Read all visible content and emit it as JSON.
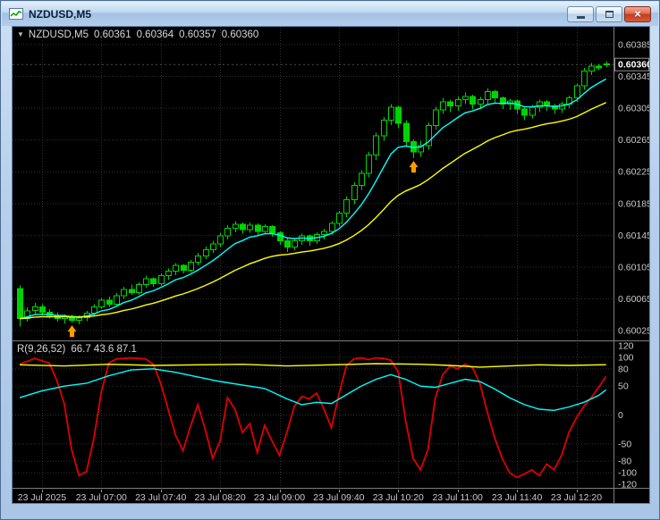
{
  "window": {
    "title": "NZDUSD,M5",
    "icons": {
      "minimize": "minimize-bar",
      "maximize": "restore-box",
      "close": "×"
    }
  },
  "main_chart": {
    "dropdown_glyph": "▼",
    "symbol": "NZDUSD,M5",
    "open": "0.60361",
    "high": "0.60364",
    "low": "0.60357",
    "close": "0.60360"
  },
  "indicator_pane": {
    "name": "R(9,26,52)",
    "values_text": "66.7 43.6 87.1"
  },
  "colors": {
    "bg": "#000000",
    "grid": "#313131",
    "axis_text": "#c8c8c8",
    "separator": "#7d7d7d",
    "candle": "#00d400",
    "ma_fast": "#00FFFF",
    "ma_slow": "#FFFF00",
    "osc_main": "#e00000",
    "osc_signal": "#00FFFF",
    "osc_base": "#FFFF00",
    "arrow": "#ff9c00",
    "current_price_line": "#4d4d4d"
  },
  "chart_data": {
    "type": "candlestick",
    "symbol": "NZDUSD",
    "timeframe": "M5",
    "current_price": 0.6036,
    "price_axis": {
      "min": 0.60025,
      "max": 0.60385,
      "values": [
        0.60385,
        0.60345,
        0.60305,
        0.60265,
        0.60225,
        0.60185,
        0.60145,
        0.60105,
        0.60065,
        0.60025
      ]
    },
    "time_axis": {
      "ticks": [
        {
          "i": 3,
          "label": "23 Jul 2025"
        },
        {
          "i": 11,
          "label": "23 Jul 07:00"
        },
        {
          "i": 19,
          "label": "23 Jul 07:40"
        },
        {
          "i": 27,
          "label": "23 Jul 08:20"
        },
        {
          "i": 35,
          "label": "23 Jul 09:00"
        },
        {
          "i": 43,
          "label": "23 Jul 09:40"
        },
        {
          "i": 51,
          "label": "23 Jul 10:20"
        },
        {
          "i": 59,
          "label": "23 Jul 11:00"
        },
        {
          "i": 67,
          "label": "23 Jul 11:40"
        },
        {
          "i": 75,
          "label": "23 Jul 12:20"
        }
      ]
    },
    "price_unit_note": "candle values are (price - 0.60000) * 100000, order [open,high,low,close]",
    "candles": [
      [
        78,
        82,
        30,
        40
      ],
      [
        40,
        54,
        36,
        50
      ],
      [
        50,
        60,
        46,
        55
      ],
      [
        55,
        58,
        44,
        48
      ],
      [
        48,
        52,
        40,
        44
      ],
      [
        44,
        48,
        36,
        40
      ],
      [
        40,
        45,
        34,
        43
      ],
      [
        43,
        45,
        35,
        38
      ],
      [
        38,
        44,
        33,
        41
      ],
      [
        41,
        50,
        37,
        47
      ],
      [
        47,
        58,
        44,
        55
      ],
      [
        55,
        66,
        52,
        63
      ],
      [
        63,
        68,
        55,
        58
      ],
      [
        58,
        72,
        56,
        69
      ],
      [
        69,
        80,
        65,
        77
      ],
      [
        77,
        83,
        70,
        73
      ],
      [
        73,
        86,
        70,
        83
      ],
      [
        83,
        94,
        79,
        90
      ],
      [
        90,
        92,
        80,
        84
      ],
      [
        84,
        97,
        81,
        94
      ],
      [
        94,
        103,
        89,
        100
      ],
      [
        100,
        110,
        95,
        107
      ],
      [
        107,
        109,
        97,
        101
      ],
      [
        101,
        114,
        98,
        111
      ],
      [
        111,
        123,
        107,
        119
      ],
      [
        119,
        131,
        115,
        127
      ],
      [
        127,
        138,
        123,
        134
      ],
      [
        134,
        148,
        130,
        144
      ],
      [
        144,
        158,
        140,
        154
      ],
      [
        154,
        163,
        149,
        159
      ],
      [
        159,
        161,
        147,
        152
      ],
      [
        152,
        161,
        148,
        158
      ],
      [
        158,
        160,
        145,
        150
      ],
      [
        150,
        159,
        146,
        156
      ],
      [
        156,
        158,
        143,
        148
      ],
      [
        148,
        150,
        133,
        138
      ],
      [
        138,
        142,
        124,
        130
      ],
      [
        130,
        141,
        126,
        138
      ],
      [
        138,
        147,
        133,
        144
      ],
      [
        144,
        146,
        132,
        138
      ],
      [
        138,
        149,
        134,
        146
      ],
      [
        146,
        153,
        140,
        150
      ],
      [
        150,
        163,
        146,
        160
      ],
      [
        160,
        176,
        156,
        173
      ],
      [
        173,
        194,
        168,
        190
      ],
      [
        190,
        212,
        184,
        208
      ],
      [
        208,
        227,
        202,
        223
      ],
      [
        223,
        250,
        218,
        246
      ],
      [
        246,
        274,
        240,
        270
      ],
      [
        270,
        294,
        264,
        290
      ],
      [
        290,
        310,
        284,
        306
      ],
      [
        306,
        308,
        280,
        286
      ],
      [
        286,
        290,
        256,
        263
      ],
      [
        263,
        266,
        242,
        250
      ],
      [
        250,
        264,
        244,
        258
      ],
      [
        258,
        287,
        253,
        283
      ],
      [
        283,
        307,
        278,
        303
      ],
      [
        303,
        318,
        298,
        313
      ],
      [
        313,
        316,
        300,
        308
      ],
      [
        308,
        320,
        302,
        316
      ],
      [
        316,
        325,
        310,
        320
      ],
      [
        320,
        322,
        304,
        310
      ],
      [
        310,
        319,
        304,
        316
      ],
      [
        316,
        330,
        311,
        326
      ],
      [
        326,
        328,
        312,
        318
      ],
      [
        318,
        320,
        304,
        310
      ],
      [
        310,
        317,
        303,
        314
      ],
      [
        314,
        316,
        298,
        304
      ],
      [
        304,
        307,
        290,
        296
      ],
      [
        296,
        309,
        292,
        306
      ],
      [
        306,
        316,
        300,
        313
      ],
      [
        313,
        315,
        302,
        308
      ],
      [
        308,
        310,
        298,
        304
      ],
      [
        304,
        313,
        299,
        310
      ],
      [
        310,
        321,
        305,
        318
      ],
      [
        318,
        336,
        313,
        333
      ],
      [
        333,
        356,
        328,
        352
      ],
      [
        352,
        362,
        347,
        358
      ],
      [
        358,
        361,
        353,
        356
      ],
      [
        361,
        364,
        357,
        360
      ]
    ],
    "moving_averages": [
      {
        "name": "fast",
        "period": 8,
        "color": "#00FFFF"
      },
      {
        "name": "slow",
        "period": 24,
        "color": "#FFFF00"
      }
    ],
    "arrows": [
      {
        "index": 7,
        "direction": "up",
        "color": "#ff9c00"
      },
      {
        "index": 53,
        "direction": "up",
        "color": "#ff9c00"
      }
    ],
    "oscillator": {
      "label": "R(9,26,52)",
      "current_values": [
        66.7,
        43.6,
        87.1
      ],
      "range": [
        -120,
        120
      ],
      "axis_values": [
        120,
        100,
        80,
        50,
        0,
        -50,
        -80,
        -100,
        -120
      ],
      "grid_values": [
        100,
        80,
        50,
        0,
        -50,
        -80,
        -100
      ],
      "series": [
        {
          "name": "main-red",
          "color": "#e00000",
          "width": 1.8,
          "points": [
            [
              0,
              88
            ],
            [
              2,
              98
            ],
            [
              4,
              90
            ],
            [
              5,
              60
            ],
            [
              6,
              20
            ],
            [
              7,
              -60
            ],
            [
              8,
              -105
            ],
            [
              9,
              -98
            ],
            [
              10,
              -40
            ],
            [
              11,
              40
            ],
            [
              12,
              90
            ],
            [
              13,
              97
            ],
            [
              15,
              99
            ],
            [
              17,
              97
            ],
            [
              18,
              88
            ],
            [
              19,
              55
            ],
            [
              20,
              10
            ],
            [
              21,
              -35
            ],
            [
              22,
              -62
            ],
            [
              23,
              -20
            ],
            [
              24,
              18
            ],
            [
              25,
              -25
            ],
            [
              26,
              -75
            ],
            [
              27,
              -45
            ],
            [
              28,
              30
            ],
            [
              29,
              10
            ],
            [
              30,
              -30
            ],
            [
              31,
              -15
            ],
            [
              32,
              -65
            ],
            [
              33,
              -18
            ],
            [
              34,
              -45
            ],
            [
              35,
              -70
            ],
            [
              36,
              -30
            ],
            [
              37,
              15
            ],
            [
              38,
              32
            ],
            [
              39,
              28
            ],
            [
              40,
              38
            ],
            [
              41,
              10
            ],
            [
              42,
              -22
            ],
            [
              43,
              35
            ],
            [
              44,
              85
            ],
            [
              45,
              97
            ],
            [
              46,
              99
            ],
            [
              47,
              96
            ],
            [
              48,
              99
            ],
            [
              49,
              98
            ],
            [
              50,
              95
            ],
            [
              51,
              75
            ],
            [
              52,
              -10
            ],
            [
              53,
              -75
            ],
            [
              54,
              -95
            ],
            [
              55,
              -60
            ],
            [
              56,
              30
            ],
            [
              57,
              70
            ],
            [
              58,
              85
            ],
            [
              59,
              80
            ],
            [
              60,
              88
            ],
            [
              61,
              82
            ],
            [
              62,
              55
            ],
            [
              63,
              5
            ],
            [
              64,
              -40
            ],
            [
              65,
              -75
            ],
            [
              66,
              -100
            ],
            [
              67,
              -108
            ],
            [
              68,
              -102
            ],
            [
              69,
              -95
            ],
            [
              70,
              -105
            ],
            [
              71,
              -85
            ],
            [
              72,
              -95
            ],
            [
              73,
              -70
            ],
            [
              74,
              -30
            ],
            [
              75,
              -5
            ],
            [
              76,
              15
            ],
            [
              77,
              30
            ],
            [
              78,
              48
            ],
            [
              79,
              66.7
            ]
          ]
        },
        {
          "name": "signal-cyan",
          "color": "#00FFFF",
          "width": 1.4,
          "points": [
            [
              0,
              30
            ],
            [
              3,
              42
            ],
            [
              6,
              50
            ],
            [
              9,
              55
            ],
            [
              12,
              68
            ],
            [
              15,
              78
            ],
            [
              18,
              80
            ],
            [
              21,
              74
            ],
            [
              24,
              66
            ],
            [
              27,
              58
            ],
            [
              30,
              52
            ],
            [
              33,
              46
            ],
            [
              36,
              28
            ],
            [
              38,
              18
            ],
            [
              40,
              22
            ],
            [
              42,
              20
            ],
            [
              44,
              35
            ],
            [
              46,
              50
            ],
            [
              48,
              62
            ],
            [
              50,
              70
            ],
            [
              52,
              62
            ],
            [
              54,
              50
            ],
            [
              56,
              48
            ],
            [
              58,
              55
            ],
            [
              60,
              62
            ],
            [
              62,
              58
            ],
            [
              64,
              45
            ],
            [
              66,
              30
            ],
            [
              68,
              18
            ],
            [
              70,
              10
            ],
            [
              72,
              8
            ],
            [
              74,
              14
            ],
            [
              76,
              22
            ],
            [
              78,
              34
            ],
            [
              79,
              43.6
            ]
          ]
        },
        {
          "name": "base-yellow",
          "color": "#FFFF00",
          "width": 1.4,
          "points": [
            [
              0,
              87
            ],
            [
              6,
              85
            ],
            [
              12,
              88
            ],
            [
              18,
              86
            ],
            [
              24,
              87
            ],
            [
              30,
              88
            ],
            [
              36,
              85
            ],
            [
              42,
              87
            ],
            [
              48,
              89
            ],
            [
              54,
              88
            ],
            [
              58,
              86
            ],
            [
              62,
              83
            ],
            [
              66,
              85
            ],
            [
              70,
              87
            ],
            [
              74,
              86
            ],
            [
              79,
              87.1
            ]
          ]
        }
      ]
    }
  }
}
